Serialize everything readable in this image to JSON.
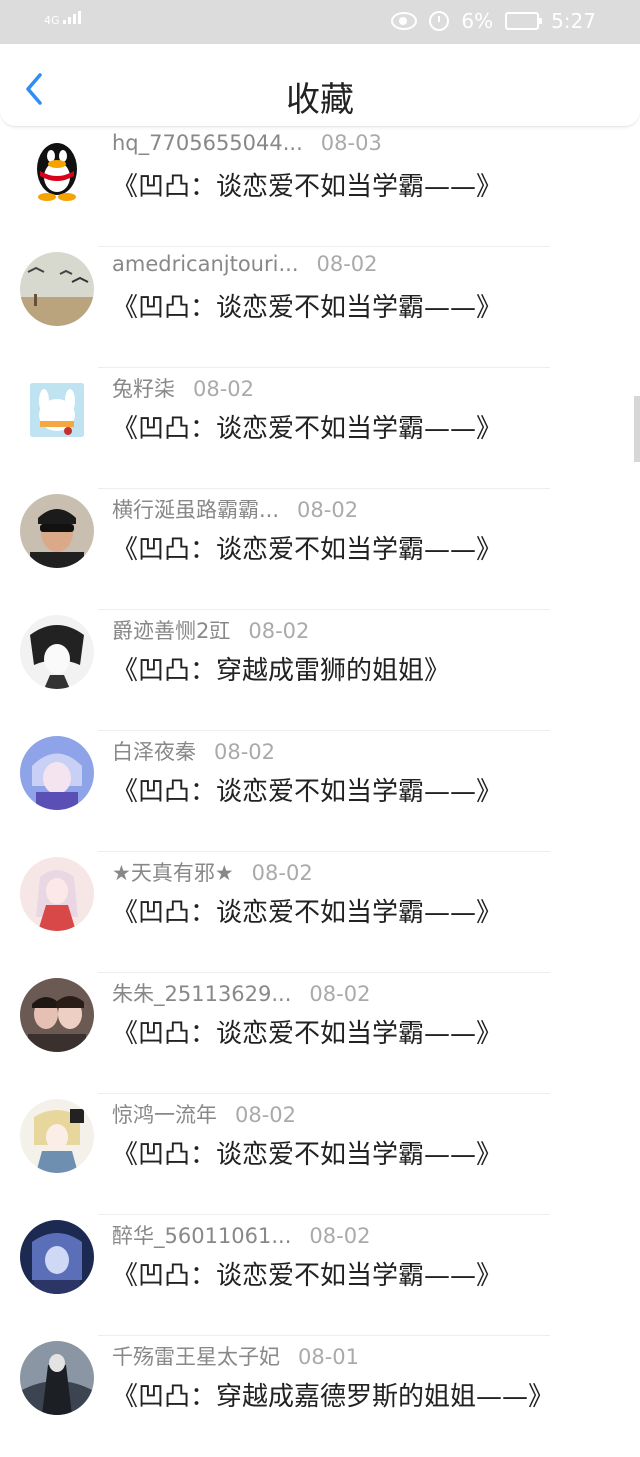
{
  "status": {
    "network": "4G",
    "battery": "6%",
    "time": "5:27"
  },
  "header": {
    "title": "收藏"
  },
  "items": [
    {
      "user": "hq_7705655044...",
      "date": "08-03",
      "book": "《凹凸：谈恋爱不如当学霸——》"
    },
    {
      "user": "amedricanjtouri...",
      "date": "08-02",
      "book": "《凹凸：谈恋爱不如当学霸——》"
    },
    {
      "user": "兔籽柒",
      "date": "08-02",
      "book": "《凹凸：谈恋爱不如当学霸——》"
    },
    {
      "user": "横行涎虽路霸霸...",
      "date": "08-02",
      "book": "《凹凸：谈恋爱不如当学霸——》"
    },
    {
      "user": "爵迹善恻2豇",
      "date": "08-02",
      "book": "《凹凸：穿越成雷狮的姐姐》"
    },
    {
      "user": "白泽夜秦",
      "date": "08-02",
      "book": "《凹凸：谈恋爱不如当学霸——》"
    },
    {
      "user": "★天真有邪★",
      "date": "08-02",
      "book": "《凹凸：谈恋爱不如当学霸——》"
    },
    {
      "user": "朱朱_25113629...",
      "date": "08-02",
      "book": "《凹凸：谈恋爱不如当学霸——》"
    },
    {
      "user": "惊鸿一流年",
      "date": "08-02",
      "book": "《凹凸：谈恋爱不如当学霸——》"
    },
    {
      "user": "醉华_56011061...",
      "date": "08-02",
      "book": "《凹凸：谈恋爱不如当学霸——》"
    },
    {
      "user": "千殇雷王星太子妃",
      "date": "08-01",
      "book": "《凹凸：穿越成嘉德罗斯的姐姐——》"
    }
  ],
  "colors": {
    "accent": "#2f8ef5",
    "status_bar": "#dcdcdc"
  }
}
